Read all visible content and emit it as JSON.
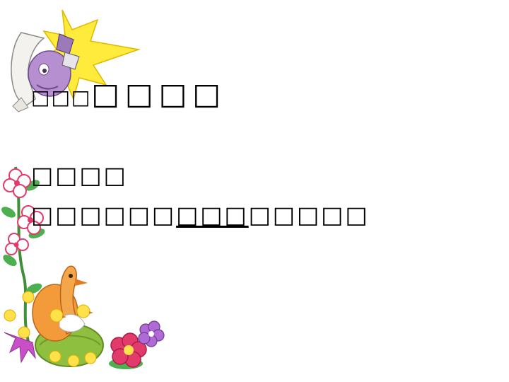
{
  "slide": {
    "title_small": "□□□",
    "title_big": "□□□□",
    "line1": "□□□□",
    "line2_before": "□□□□□□",
    "line2_underlined": "□□□",
    "line2_after": "□□□□□"
  },
  "colors": {
    "background": "#ffffff",
    "text": "#000000",
    "burst_yellow": "#ffeb3b",
    "dino_purple": "#b58fd0",
    "flower_pink": "#e23a6a",
    "leaf_green": "#4caf50",
    "duck_orange": "#f39a3a",
    "chick_yellow": "#ffe14a"
  },
  "icons": [
    "hatching-dinosaur-illustration",
    "flower-vine-illustration",
    "duck-in-nest-illustration"
  ]
}
